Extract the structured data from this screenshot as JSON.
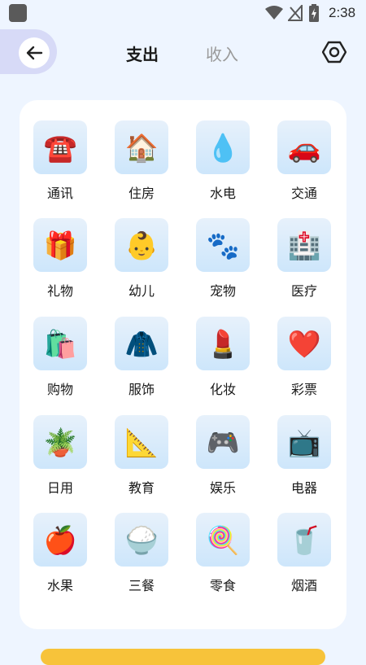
{
  "status": {
    "time": "2:38"
  },
  "header": {
    "tab_expense": "支出",
    "tab_income": "收入"
  },
  "categories": [
    {
      "label": "通讯",
      "icon": "☎️"
    },
    {
      "label": "住房",
      "icon": "🏠"
    },
    {
      "label": "水电",
      "icon": "💧"
    },
    {
      "label": "交通",
      "icon": "🚗"
    },
    {
      "label": "礼物",
      "icon": "🎁"
    },
    {
      "label": "幼儿",
      "icon": "👶"
    },
    {
      "label": "宠物",
      "icon": "🐾"
    },
    {
      "label": "医疗",
      "icon": "🏥"
    },
    {
      "label": "购物",
      "icon": "🛍️"
    },
    {
      "label": "服饰",
      "icon": "🧥"
    },
    {
      "label": "化妆",
      "icon": "💄"
    },
    {
      "label": "彩票",
      "icon": "❤️"
    },
    {
      "label": "日用",
      "icon": "🪴"
    },
    {
      "label": "教育",
      "icon": "📐"
    },
    {
      "label": "娱乐",
      "icon": "🎮"
    },
    {
      "label": "电器",
      "icon": "📺"
    },
    {
      "label": "水果",
      "icon": "🍎"
    },
    {
      "label": "三餐",
      "icon": "🍚"
    },
    {
      "label": "零食",
      "icon": "🍭"
    },
    {
      "label": "烟酒",
      "icon": "🥤"
    }
  ]
}
